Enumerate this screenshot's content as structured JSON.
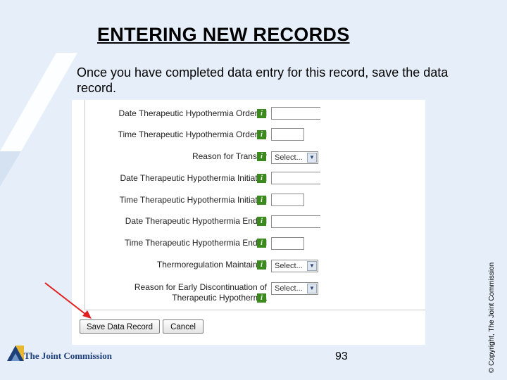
{
  "slide": {
    "title": "ENTERING NEW RECORDS",
    "instruction": "Once you have completed data entry for this record, save the data record.",
    "copyright": "© Copyright, The Joint Commission",
    "page_number": "93",
    "logo_text": "The Joint Commission"
  },
  "form": {
    "info_glyph": "i",
    "fields": [
      {
        "label": "Date Therapeutic Hypothermia Ordered",
        "type": "date",
        "value": ""
      },
      {
        "label": "Time Therapeutic Hypothermia Ordered",
        "type": "time",
        "value": ""
      },
      {
        "label": "Reason for Transfer",
        "type": "select",
        "value": "Select..."
      },
      {
        "label": "Date Therapeutic Hypothermia Initiated",
        "type": "date",
        "value": ""
      },
      {
        "label": "Time Therapeutic Hypothermia Initiated",
        "type": "time",
        "value": ""
      },
      {
        "label": "Date Therapeutic Hypothermia Ended",
        "type": "date",
        "value": ""
      },
      {
        "label": "Time Therapeutic Hypothermia Ended",
        "type": "time",
        "value": ""
      },
      {
        "label": "Thermoregulation Maintained",
        "type": "select",
        "value": "Select..."
      },
      {
        "label_line1": "Reason for Early Discontinuation of",
        "label_line2": "Therapeutic Hypothermia",
        "type": "select",
        "value": "Select..."
      }
    ],
    "buttons": {
      "save": "Save Data Record",
      "cancel": "Cancel"
    }
  },
  "colors": {
    "background": "#e6eff9",
    "arrow": "#e02020",
    "info_icon": "#3a8a1d",
    "logo_blue": "#1d3f7a",
    "logo_gold": "#e8b830"
  }
}
